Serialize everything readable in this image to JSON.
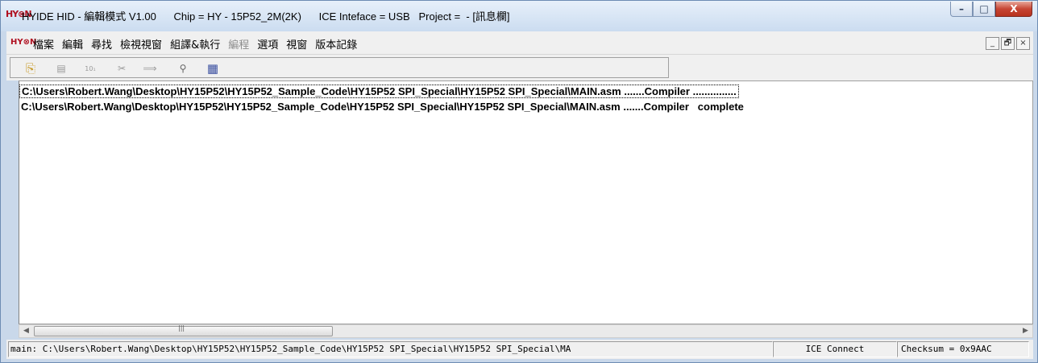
{
  "titlebar": {
    "logo": "HY⊗N",
    "title": "HYIDE HID - 編輯模式 V1.00      Chip = HY - 15P52_2M(2K)      ICE Inteface = USB   Project =  - [訊息欄]",
    "minimize": "–",
    "maximize": "□",
    "close": "X"
  },
  "menubar": {
    "logo": "HY⊗N",
    "items": [
      {
        "label": "檔案"
      },
      {
        "label": "編輯"
      },
      {
        "label": "尋找"
      },
      {
        "label": "檢視視窗"
      },
      {
        "label": "組譯&執行"
      },
      {
        "label": "編程"
      },
      {
        "label": "選項"
      },
      {
        "label": "視窗"
      },
      {
        "label": "版本記錄"
      }
    ],
    "mdi": {
      "minimize": "_",
      "restore": "🗗",
      "close": "×"
    }
  },
  "toolbar": {
    "buttons": [
      {
        "icon": "copy-icon",
        "glyph": "⎘"
      },
      {
        "icon": "document-icon",
        "glyph": "▤"
      },
      {
        "icon": "binary-icon",
        "glyph": "10₁"
      },
      {
        "icon": "tools-icon",
        "glyph": "✂"
      },
      {
        "icon": "chip-icon",
        "glyph": "⟹"
      },
      {
        "icon": "binoculars-icon",
        "glyph": "⚲"
      },
      {
        "icon": "grid-icon",
        "glyph": "▦"
      }
    ]
  },
  "output": {
    "lines": [
      "C:\\Users\\Robert.Wang\\Desktop\\HY15P52\\HY15P52_Sample_Code\\HY15P52 SPI_Special\\HY15P52 SPI_Special\\MAIN.asm .......Compiler ...............",
      "C:\\Users\\Robert.Wang\\Desktop\\HY15P52\\HY15P52_Sample_Code\\HY15P52 SPI_Special\\HY15P52 SPI_Special\\MAIN.asm .......Compiler   complete"
    ]
  },
  "scrollbar": {
    "left_arrow": "◀",
    "grip": "|||",
    "right_arrow": "▶"
  },
  "statusbar": {
    "path": "main: C:\\Users\\Robert.Wang\\Desktop\\HY15P52\\HY15P52_Sample_Code\\HY15P52 SPI_Special\\HY15P52 SPI_Special\\MA",
    "ice": "ICE Connect",
    "checksum": "Checksum = 0x9AAC"
  },
  "colors": {
    "titlebar_top": "#e7f0fa",
    "titlebar_bottom": "#cbdcf0",
    "close_button": "#c74634",
    "logo": "#b01020"
  }
}
